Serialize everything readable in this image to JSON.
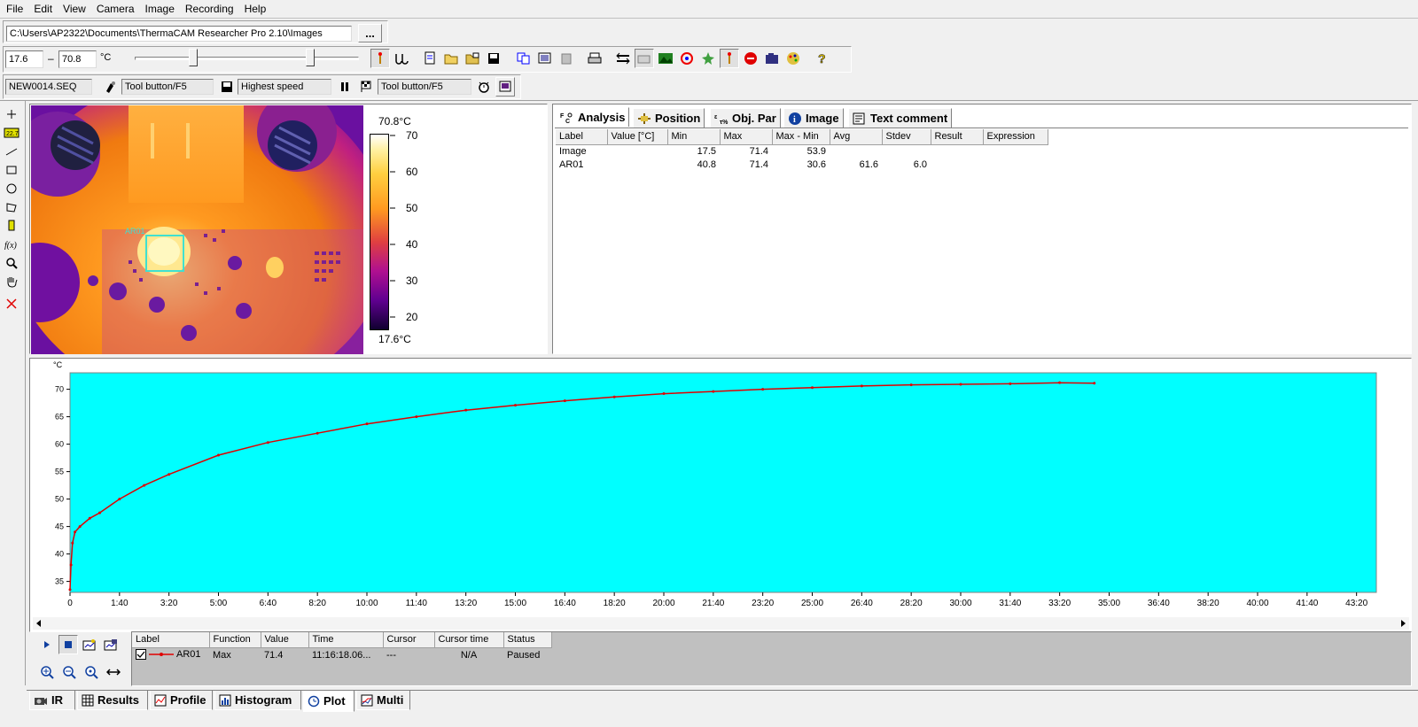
{
  "menu": [
    "File",
    "Edit",
    "View",
    "Camera",
    "Image",
    "Recording",
    "Help"
  ],
  "path_bar": {
    "value": "C:\\Users\\AP2322\\Documents\\ThermaCAM Researcher Pro 2.10\\Images",
    "browse_label": "..."
  },
  "range_bar": {
    "min": "17.6",
    "dash": "–",
    "max": "70.8",
    "unit": "°C"
  },
  "record_bar": {
    "file": "NEW0014.SEQ",
    "trigger_start": "Tool button/F5",
    "speed": "Highest speed",
    "trigger_stop": "Tool button/F5"
  },
  "ir_image": {
    "area_label": "AR01",
    "scale_max_label": "70.8°C",
    "scale_min_label": "17.6°C",
    "scale_ticks": [
      "70",
      "60",
      "50",
      "40",
      "30",
      "20"
    ]
  },
  "analysis_tabs": [
    "Analysis",
    "Position",
    "Obj. Par",
    "Image",
    "Text comment"
  ],
  "analysis_table": {
    "columns": [
      "Label",
      "Value [°C]",
      "Min",
      "Max",
      "Max - Min",
      "Avg",
      "Stdev",
      "Result",
      "Expression"
    ],
    "rows": [
      [
        "Image",
        "",
        "17.5",
        "71.4",
        "53.9",
        "",
        "",
        "",
        ""
      ],
      [
        "AR01",
        "",
        "40.8",
        "71.4",
        "30.6",
        "61.6",
        "6.0",
        "",
        ""
      ]
    ]
  },
  "chart_data": {
    "type": "line",
    "ylabel": "°C",
    "ylim": [
      33,
      73
    ],
    "xlim": [
      0,
      2640
    ],
    "yticks": [
      35,
      40,
      45,
      50,
      55,
      60,
      65,
      70
    ],
    "xtick_labels": [
      "0",
      "1:40",
      "3:20",
      "5:00",
      "6:40",
      "8:20",
      "10:00",
      "11:40",
      "13:20",
      "15:00",
      "16:40",
      "18:20",
      "20:00",
      "21:40",
      "23:20",
      "25:00",
      "26:40",
      "28:20",
      "30:00",
      "31:40",
      "33:20",
      "35:00",
      "36:40",
      "38:20",
      "40:00",
      "41:40",
      "43:20"
    ],
    "plot_background": "#00ffff",
    "series": [
      {
        "name": "AR01",
        "color": "#e00000",
        "x": [
          0,
          2,
          5,
          10,
          20,
          40,
          60,
          100,
          150,
          200,
          300,
          400,
          500,
          600,
          700,
          800,
          900,
          1000,
          1100,
          1200,
          1300,
          1400,
          1500,
          1600,
          1700,
          1800,
          1900,
          2000,
          2070
        ],
        "y": [
          33.5,
          38,
          42,
          44,
          45,
          46.5,
          47.5,
          50,
          52.5,
          54.5,
          58,
          60.3,
          62,
          63.7,
          65,
          66.2,
          67.1,
          67.9,
          68.6,
          69.2,
          69.6,
          70.0,
          70.3,
          70.6,
          70.8,
          70.9,
          71.0,
          71.2,
          71.1
        ]
      }
    ]
  },
  "plot_legend": {
    "columns": [
      "Label",
      "Function",
      "Value",
      "Time",
      "Cursor",
      "Cursor time",
      "Status"
    ],
    "rows": [
      {
        "label": "AR01",
        "function": "Max",
        "value": "71.4",
        "time": "11:16:18.06...",
        "cursor": "---",
        "cursor_time": "N/A",
        "status": "Paused"
      }
    ]
  },
  "bottom_tabs": [
    "IR",
    "Results",
    "Profile",
    "Histogram",
    "Plot",
    "Multi"
  ],
  "colors": {
    "plot_bg": "#00ffff",
    "series": "#e00000",
    "area_box": "#40e0d0"
  }
}
